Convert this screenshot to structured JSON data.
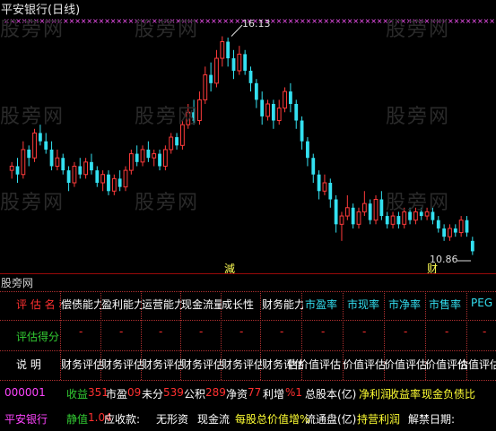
{
  "title": "平安银行(日线)",
  "watermark": "股旁网",
  "watermark_header": "股旁网",
  "chart": {
    "high_label": "16.13",
    "low_label": "10.86",
    "bottom_marker_left": "減",
    "bottom_marker_right": "财",
    "up_color": "#ff3b3b",
    "down_color": "#33e0f0",
    "star_color": "#ff55ff",
    "candles": [
      [
        12.9,
        13.0,
        12.7,
        13.1
      ],
      [
        13.0,
        12.8,
        12.6,
        13.2
      ],
      [
        12.8,
        13.4,
        12.7,
        13.6
      ],
      [
        13.4,
        13.2,
        13.0,
        13.5
      ],
      [
        13.2,
        13.8,
        13.1,
        13.9
      ],
      [
        13.8,
        13.6,
        13.5,
        14.0
      ],
      [
        13.6,
        13.4,
        13.3,
        13.8
      ],
      [
        13.4,
        13.0,
        12.9,
        13.6
      ],
      [
        13.0,
        13.2,
        12.9,
        13.4
      ],
      [
        13.2,
        12.9,
        12.8,
        13.3
      ],
      [
        12.9,
        12.6,
        12.4,
        13.0
      ],
      [
        12.6,
        13.0,
        12.5,
        13.1
      ],
      [
        13.0,
        12.8,
        12.7,
        13.2
      ],
      [
        12.8,
        13.1,
        12.7,
        13.2
      ],
      [
        13.1,
        12.9,
        12.8,
        13.3
      ],
      [
        12.9,
        12.6,
        12.5,
        13.0
      ],
      [
        12.6,
        12.8,
        12.4,
        12.9
      ],
      [
        12.8,
        12.4,
        12.3,
        12.9
      ],
      [
        12.4,
        12.7,
        12.3,
        12.8
      ],
      [
        12.7,
        12.5,
        12.4,
        12.9
      ],
      [
        12.5,
        12.9,
        12.4,
        13.0
      ],
      [
        12.9,
        13.3,
        12.8,
        13.4
      ],
      [
        13.3,
        13.1,
        13.0,
        13.5
      ],
      [
        13.1,
        13.4,
        13.0,
        13.5
      ],
      [
        13.4,
        13.2,
        13.1,
        13.6
      ],
      [
        13.2,
        13.3,
        13.0,
        13.4
      ],
      [
        13.3,
        13.0,
        12.9,
        13.4
      ],
      [
        13.0,
        13.4,
        12.9,
        13.5
      ],
      [
        13.4,
        13.7,
        13.3,
        13.8
      ],
      [
        13.7,
        13.5,
        13.4,
        13.8
      ],
      [
        13.5,
        14.0,
        13.4,
        14.1
      ],
      [
        14.0,
        14.3,
        13.9,
        14.5
      ],
      [
        14.3,
        14.1,
        14.0,
        14.6
      ],
      [
        14.1,
        14.6,
        14.0,
        14.8
      ],
      [
        14.6,
        15.2,
        14.5,
        15.4
      ],
      [
        15.2,
        15.0,
        14.8,
        15.5
      ],
      [
        15.0,
        15.6,
        14.9,
        15.8
      ],
      [
        15.6,
        16.0,
        15.4,
        16.13
      ],
      [
        16.0,
        15.6,
        15.4,
        16.1
      ],
      [
        15.6,
        15.3,
        15.1,
        15.8
      ],
      [
        15.3,
        15.7,
        15.2,
        15.9
      ],
      [
        15.7,
        15.3,
        15.2,
        15.8
      ],
      [
        15.3,
        15.0,
        14.8,
        15.4
      ],
      [
        15.0,
        14.6,
        14.4,
        15.1
      ],
      [
        14.6,
        14.2,
        14.0,
        14.8
      ],
      [
        14.2,
        14.5,
        14.1,
        14.6
      ],
      [
        14.5,
        14.1,
        13.9,
        14.6
      ],
      [
        14.1,
        14.4,
        14.0,
        14.6
      ],
      [
        14.4,
        14.8,
        14.3,
        14.9
      ],
      [
        14.8,
        14.5,
        14.3,
        15.0
      ],
      [
        14.5,
        14.1,
        13.9,
        14.6
      ],
      [
        14.1,
        13.6,
        13.4,
        14.2
      ],
      [
        13.6,
        13.2,
        13.0,
        13.7
      ],
      [
        13.2,
        12.8,
        12.6,
        13.3
      ],
      [
        12.8,
        12.4,
        12.2,
        12.9
      ],
      [
        12.4,
        12.6,
        12.3,
        12.8
      ],
      [
        12.6,
        12.2,
        12.0,
        12.7
      ],
      [
        12.2,
        11.6,
        11.4,
        12.3
      ],
      [
        11.6,
        11.8,
        11.2,
        11.9
      ],
      [
        11.8,
        12.0,
        11.7,
        12.3
      ],
      [
        12.0,
        11.6,
        11.5,
        12.1
      ],
      [
        11.6,
        11.9,
        11.5,
        12.0
      ],
      [
        11.9,
        12.1,
        11.8,
        12.4
      ],
      [
        12.1,
        11.7,
        11.6,
        12.2
      ],
      [
        11.7,
        12.2,
        11.6,
        12.3
      ],
      [
        12.2,
        11.8,
        11.7,
        12.4
      ],
      [
        11.8,
        11.6,
        11.5,
        11.9
      ],
      [
        11.6,
        11.8,
        11.5,
        11.9
      ],
      [
        11.8,
        11.6,
        11.5,
        11.9
      ],
      [
        11.6,
        11.9,
        11.5,
        12.0
      ],
      [
        11.9,
        11.7,
        11.6,
        12.0
      ],
      [
        11.7,
        11.9,
        11.6,
        12.0
      ],
      [
        11.9,
        11.8,
        11.7,
        12.0
      ],
      [
        11.8,
        11.9,
        11.7,
        12.0
      ],
      [
        11.9,
        11.7,
        11.6,
        12.0
      ],
      [
        11.7,
        11.5,
        11.4,
        11.8
      ],
      [
        11.5,
        11.3,
        11.2,
        11.6
      ],
      [
        11.3,
        11.5,
        11.2,
        11.6
      ],
      [
        11.5,
        11.4,
        11.3,
        11.6
      ],
      [
        11.4,
        11.7,
        11.3,
        11.8
      ],
      [
        11.7,
        11.4,
        11.3,
        11.8
      ],
      [
        11.2,
        10.95,
        10.86,
        11.3
      ]
    ]
  },
  "panel": {
    "header_label": "股旁网",
    "row1": {
      "label": "评 估 名 称",
      "cols": [
        "偿债能力",
        "盈利能力",
        "运营能力",
        "现金流量",
        "成长性",
        "财务能力",
        "市盈率",
        "市现率",
        "市净率",
        "市售率",
        "PEG"
      ]
    },
    "row2": {
      "label": "评估得分",
      "values": [
        "-",
        "-",
        "-",
        "-",
        "-",
        "-",
        "-",
        "-",
        "-",
        "-",
        "-"
      ]
    },
    "row3": {
      "label": "说 明",
      "values": [
        "财务评估",
        "财务评估",
        "财务评估",
        "财务评估",
        "财务评估",
        "财务评估",
        "估价值评估",
        "价值评估",
        "价值评估",
        "价值评估",
        "价值评估"
      ]
    },
    "info1": {
      "code": "000001",
      "items": [
        {
          "k": "收益",
          "v": "351"
        },
        {
          "k": "市盈",
          "v": "09"
        },
        {
          "k": "未分",
          "v": "539"
        },
        {
          "k": "公积",
          "v": "289"
        },
        {
          "k": "净资",
          "v": "77"
        },
        {
          "k": "利增",
          "v": "%1"
        },
        {
          "k": "总股本(亿)",
          "v": ""
        },
        {
          "k": "净利润",
          "v": ""
        },
        {
          "k": "收益率",
          "v": ""
        },
        {
          "k": "现金负债比",
          "v": ""
        }
      ]
    },
    "info2": {
      "name": "平安银行",
      "items": [
        {
          "k": "静值",
          "v": "1.04"
        },
        {
          "k": "应收款:",
          "v": ""
        },
        {
          "k": "无形资",
          "v": ""
        },
        {
          "k": "现金流",
          "v": ""
        },
        {
          "k": "每股总价值",
          "v": ""
        },
        {
          "k": "增%",
          "v": ""
        },
        {
          "k": "流通盘(亿)",
          "v": ""
        },
        {
          "k": "持营利润",
          "v": ""
        },
        {
          "k": "解禁日期:",
          "v": ""
        }
      ]
    }
  }
}
